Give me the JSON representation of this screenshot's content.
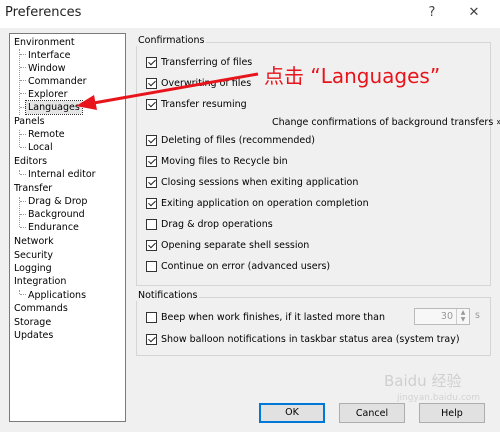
{
  "window": {
    "title": "Preferences",
    "help_glyph": "?",
    "close_glyph": "✕"
  },
  "tree": {
    "environment": "Environment",
    "interface": "Interface",
    "window": "Window",
    "commander": "Commander",
    "explorer": "Explorer",
    "languages": "Languages",
    "panels": "Panels",
    "remote": "Remote",
    "local": "Local",
    "editors": "Editors",
    "internal_editor": "Internal editor",
    "transfer": "Transfer",
    "drag_drop": "Drag & Drop",
    "background": "Background",
    "endurance": "Endurance",
    "network": "Network",
    "security": "Security",
    "logging": "Logging",
    "integration": "Integration",
    "applications": "Applications",
    "commands": "Commands",
    "storage": "Storage",
    "updates": "Updates"
  },
  "confirmations": {
    "label": "Confirmations",
    "transferring": "Transferring of files",
    "overwriting": "Overwriting of files",
    "transfer_resuming": "Transfer resuming",
    "change_link": "Change confirmations of background transfers »",
    "deleting": "Deleting of files (recommended)",
    "moving_recycle": "Moving files to Recycle bin",
    "closing_sessions": "Closing sessions when exiting application",
    "exiting_app": "Exiting application on operation completion",
    "drag_drop": "Drag & drop operations",
    "opening_shell": "Opening separate shell session",
    "continue_error": "Continue on error (advanced users)",
    "states": {
      "transferring": true,
      "overwriting": true,
      "transfer_resuming": true,
      "deleting": true,
      "moving_recycle": true,
      "closing_sessions": true,
      "exiting_app": true,
      "drag_drop": false,
      "opening_shell": true,
      "continue_error": false
    }
  },
  "notifications": {
    "label": "Notifications",
    "beep": "Beep when work finishes, if it lasted more than",
    "beep_value": "30",
    "beep_unit": "s",
    "balloon": "Show balloon notifications in taskbar status area (system tray)",
    "states": {
      "beep": false,
      "balloon": true
    }
  },
  "buttons": {
    "ok": "OK",
    "cancel": "Cancel",
    "help": "Help"
  },
  "annotation": {
    "text": "点击 “Languages”",
    "color": "#e8141b"
  },
  "watermark": {
    "text": "Baidu 经验",
    "sub": "jingyan.baidu.com"
  }
}
